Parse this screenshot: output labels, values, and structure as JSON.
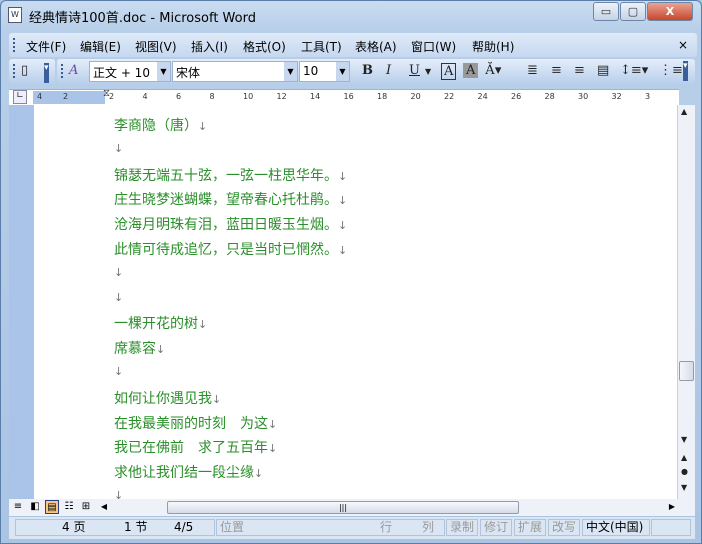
{
  "window": {
    "title": "经典情诗100首.doc - Microsoft Word",
    "minimize": "▭",
    "maximize": "▢",
    "close": "X"
  },
  "menu": {
    "items": [
      "文件(F)",
      "编辑(E)",
      "视图(V)",
      "插入(I)",
      "格式(O)",
      "工具(T)",
      "表格(A)",
      "窗口(W)",
      "帮助(H)"
    ],
    "close": "×"
  },
  "toolbar": {
    "style": "正文 + 10",
    "font": "宋体",
    "size": "10",
    "bold": "B",
    "italic": "I",
    "underline": "U",
    "char_border": "A",
    "char_shade": "A"
  },
  "ruler": {
    "ticks": [
      "4",
      "2",
      "2",
      "4",
      "6",
      "8",
      "10",
      "12",
      "14",
      "16",
      "18",
      "20",
      "22",
      "24",
      "26",
      "28",
      "30",
      "32",
      "3"
    ]
  },
  "document": {
    "lines": [
      "李商隐（唐）",
      "",
      "锦瑟无端五十弦，一弦一柱思华年。",
      "庄生晓梦迷蝴蝶，望帝春心托杜鹃。",
      "沧海月明珠有泪，蓝田日暖玉生烟。",
      "此情可待成追忆，只是当时已惘然。",
      "",
      "",
      "一棵开花的树",
      "席慕容",
      "",
      "如何让你遇见我",
      "在我最美丽的时刻　为这",
      "我已在佛前　求了五百年",
      "求他让我们结一段尘缘",
      ""
    ],
    "paragraph_mark": "↓"
  },
  "status": {
    "page": "4 页",
    "section": "1 节",
    "pages": "4/5",
    "position": "位置",
    "line": "行",
    "col": "列",
    "rec": "录制",
    "trk": "修订",
    "ext": "扩展",
    "ovr": "改写",
    "lang": "中文(中国)"
  },
  "colors": {
    "text": "#2a8f2a"
  }
}
